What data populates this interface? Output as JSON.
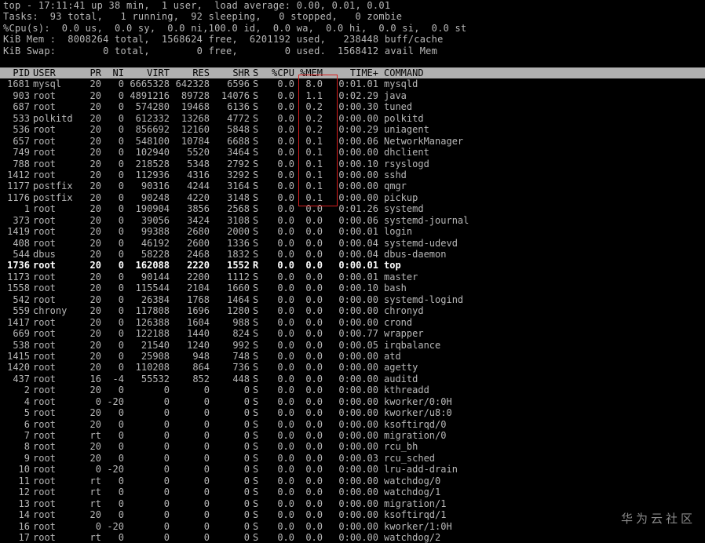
{
  "summary": {
    "line1": "top - 17:11:41 up 38 min,  1 user,  load average: 0.00, 0.01, 0.01",
    "line2": "Tasks:  93 total,   1 running,  92 sleeping,   0 stopped,   0 zombie",
    "line3": "%Cpu(s):  0.0 us,  0.0 sy,  0.0 ni,100.0 id,  0.0 wa,  0.0 hi,  0.0 si,  0.0 st",
    "line4": "KiB Mem :  8008264 total,  1568624 free,  6201192 used,   238448 buff/cache",
    "line5": "KiB Swap:        0 total,        0 free,        0 used.  1568412 avail Mem"
  },
  "header": {
    "pid": "PID",
    "user": "USER",
    "pr": "PR",
    "ni": "NI",
    "virt": "VIRT",
    "res": "RES",
    "shr": "SHR",
    "s": "S",
    "cpu": "%CPU",
    "mem": "%MEM",
    "time": "TIME+",
    "command": "COMMAND"
  },
  "highlight": {
    "color": "#d82020",
    "column": "%MEM"
  },
  "processes": [
    {
      "pid": "1681",
      "user": "mysql",
      "pr": "20",
      "ni": "0",
      "virt": "6665328",
      "res": "642328",
      "shr": "6596",
      "s": "S",
      "cpu": "0.0",
      "mem": "8.0",
      "time": "0:01.01",
      "command": "mysqld"
    },
    {
      "pid": "903",
      "user": "root",
      "pr": "20",
      "ni": "0",
      "virt": "4891216",
      "res": "89728",
      "shr": "14076",
      "s": "S",
      "cpu": "0.0",
      "mem": "1.1",
      "time": "0:02.29",
      "command": "java"
    },
    {
      "pid": "687",
      "user": "root",
      "pr": "20",
      "ni": "0",
      "virt": "574280",
      "res": "19468",
      "shr": "6136",
      "s": "S",
      "cpu": "0.0",
      "mem": "0.2",
      "time": "0:00.30",
      "command": "tuned"
    },
    {
      "pid": "533",
      "user": "polkitd",
      "pr": "20",
      "ni": "0",
      "virt": "612332",
      "res": "13268",
      "shr": "4772",
      "s": "S",
      "cpu": "0.0",
      "mem": "0.2",
      "time": "0:00.00",
      "command": "polkitd"
    },
    {
      "pid": "536",
      "user": "root",
      "pr": "20",
      "ni": "0",
      "virt": "856692",
      "res": "12160",
      "shr": "5848",
      "s": "S",
      "cpu": "0.0",
      "mem": "0.2",
      "time": "0:00.29",
      "command": "uniagent"
    },
    {
      "pid": "657",
      "user": "root",
      "pr": "20",
      "ni": "0",
      "virt": "548100",
      "res": "10784",
      "shr": "6688",
      "s": "S",
      "cpu": "0.0",
      "mem": "0.1",
      "time": "0:00.06",
      "command": "NetworkManager"
    },
    {
      "pid": "749",
      "user": "root",
      "pr": "20",
      "ni": "0",
      "virt": "102940",
      "res": "5520",
      "shr": "3464",
      "s": "S",
      "cpu": "0.0",
      "mem": "0.1",
      "time": "0:00.00",
      "command": "dhclient"
    },
    {
      "pid": "788",
      "user": "root",
      "pr": "20",
      "ni": "0",
      "virt": "218528",
      "res": "5348",
      "shr": "2792",
      "s": "S",
      "cpu": "0.0",
      "mem": "0.1",
      "time": "0:00.10",
      "command": "rsyslogd"
    },
    {
      "pid": "1412",
      "user": "root",
      "pr": "20",
      "ni": "0",
      "virt": "112936",
      "res": "4316",
      "shr": "3292",
      "s": "S",
      "cpu": "0.0",
      "mem": "0.1",
      "time": "0:00.00",
      "command": "sshd"
    },
    {
      "pid": "1177",
      "user": "postfix",
      "pr": "20",
      "ni": "0",
      "virt": "90316",
      "res": "4244",
      "shr": "3164",
      "s": "S",
      "cpu": "0.0",
      "mem": "0.1",
      "time": "0:00.00",
      "command": "qmgr"
    },
    {
      "pid": "1176",
      "user": "postfix",
      "pr": "20",
      "ni": "0",
      "virt": "90248",
      "res": "4220",
      "shr": "3148",
      "s": "S",
      "cpu": "0.0",
      "mem": "0.1",
      "time": "0:00.00",
      "command": "pickup"
    },
    {
      "pid": "1",
      "user": "root",
      "pr": "20",
      "ni": "0",
      "virt": "190904",
      "res": "3856",
      "shr": "2568",
      "s": "S",
      "cpu": "0.0",
      "mem": "0.0",
      "time": "0:01.26",
      "command": "systemd"
    },
    {
      "pid": "373",
      "user": "root",
      "pr": "20",
      "ni": "0",
      "virt": "39056",
      "res": "3424",
      "shr": "3108",
      "s": "S",
      "cpu": "0.0",
      "mem": "0.0",
      "time": "0:00.06",
      "command": "systemd-journal"
    },
    {
      "pid": "1419",
      "user": "root",
      "pr": "20",
      "ni": "0",
      "virt": "99388",
      "res": "2680",
      "shr": "2000",
      "s": "S",
      "cpu": "0.0",
      "mem": "0.0",
      "time": "0:00.01",
      "command": "login"
    },
    {
      "pid": "408",
      "user": "root",
      "pr": "20",
      "ni": "0",
      "virt": "46192",
      "res": "2600",
      "shr": "1336",
      "s": "S",
      "cpu": "0.0",
      "mem": "0.0",
      "time": "0:00.04",
      "command": "systemd-udevd"
    },
    {
      "pid": "544",
      "user": "dbus",
      "pr": "20",
      "ni": "0",
      "virt": "58228",
      "res": "2468",
      "shr": "1832",
      "s": "S",
      "cpu": "0.0",
      "mem": "0.0",
      "time": "0:00.04",
      "command": "dbus-daemon"
    },
    {
      "pid": "1736",
      "user": "root",
      "pr": "20",
      "ni": "0",
      "virt": "162088",
      "res": "2220",
      "shr": "1552",
      "s": "R",
      "cpu": "0.0",
      "mem": "0.0",
      "time": "0:00.01",
      "command": "top",
      "bold": true
    },
    {
      "pid": "1173",
      "user": "root",
      "pr": "20",
      "ni": "0",
      "virt": "90144",
      "res": "2200",
      "shr": "1112",
      "s": "S",
      "cpu": "0.0",
      "mem": "0.0",
      "time": "0:00.01",
      "command": "master"
    },
    {
      "pid": "1558",
      "user": "root",
      "pr": "20",
      "ni": "0",
      "virt": "115544",
      "res": "2104",
      "shr": "1660",
      "s": "S",
      "cpu": "0.0",
      "mem": "0.0",
      "time": "0:00.10",
      "command": "bash"
    },
    {
      "pid": "542",
      "user": "root",
      "pr": "20",
      "ni": "0",
      "virt": "26384",
      "res": "1768",
      "shr": "1464",
      "s": "S",
      "cpu": "0.0",
      "mem": "0.0",
      "time": "0:00.00",
      "command": "systemd-logind"
    },
    {
      "pid": "559",
      "user": "chrony",
      "pr": "20",
      "ni": "0",
      "virt": "117808",
      "res": "1696",
      "shr": "1280",
      "s": "S",
      "cpu": "0.0",
      "mem": "0.0",
      "time": "0:00.00",
      "command": "chronyd"
    },
    {
      "pid": "1417",
      "user": "root",
      "pr": "20",
      "ni": "0",
      "virt": "126388",
      "res": "1604",
      "shr": "988",
      "s": "S",
      "cpu": "0.0",
      "mem": "0.0",
      "time": "0:00.00",
      "command": "crond"
    },
    {
      "pid": "669",
      "user": "root",
      "pr": "20",
      "ni": "0",
      "virt": "122188",
      "res": "1440",
      "shr": "824",
      "s": "S",
      "cpu": "0.0",
      "mem": "0.0",
      "time": "0:00.77",
      "command": "wrapper"
    },
    {
      "pid": "538",
      "user": "root",
      "pr": "20",
      "ni": "0",
      "virt": "21540",
      "res": "1240",
      "shr": "992",
      "s": "S",
      "cpu": "0.0",
      "mem": "0.0",
      "time": "0:00.05",
      "command": "irqbalance"
    },
    {
      "pid": "1415",
      "user": "root",
      "pr": "20",
      "ni": "0",
      "virt": "25908",
      "res": "948",
      "shr": "748",
      "s": "S",
      "cpu": "0.0",
      "mem": "0.0",
      "time": "0:00.00",
      "command": "atd"
    },
    {
      "pid": "1420",
      "user": "root",
      "pr": "20",
      "ni": "0",
      "virt": "110208",
      "res": "864",
      "shr": "736",
      "s": "S",
      "cpu": "0.0",
      "mem": "0.0",
      "time": "0:00.00",
      "command": "agetty"
    },
    {
      "pid": "437",
      "user": "root",
      "pr": "16",
      "ni": "-4",
      "virt": "55532",
      "res": "852",
      "shr": "448",
      "s": "S",
      "cpu": "0.0",
      "mem": "0.0",
      "time": "0:00.00",
      "command": "auditd"
    },
    {
      "pid": "2",
      "user": "root",
      "pr": "20",
      "ni": "0",
      "virt": "0",
      "res": "0",
      "shr": "0",
      "s": "S",
      "cpu": "0.0",
      "mem": "0.0",
      "time": "0:00.00",
      "command": "kthreadd"
    },
    {
      "pid": "4",
      "user": "root",
      "pr": "0",
      "ni": "-20",
      "virt": "0",
      "res": "0",
      "shr": "0",
      "s": "S",
      "cpu": "0.0",
      "mem": "0.0",
      "time": "0:00.00",
      "command": "kworker/0:0H"
    },
    {
      "pid": "5",
      "user": "root",
      "pr": "20",
      "ni": "0",
      "virt": "0",
      "res": "0",
      "shr": "0",
      "s": "S",
      "cpu": "0.0",
      "mem": "0.0",
      "time": "0:00.00",
      "command": "kworker/u8:0"
    },
    {
      "pid": "6",
      "user": "root",
      "pr": "20",
      "ni": "0",
      "virt": "0",
      "res": "0",
      "shr": "0",
      "s": "S",
      "cpu": "0.0",
      "mem": "0.0",
      "time": "0:00.00",
      "command": "ksoftirqd/0"
    },
    {
      "pid": "7",
      "user": "root",
      "pr": "rt",
      "ni": "0",
      "virt": "0",
      "res": "0",
      "shr": "0",
      "s": "S",
      "cpu": "0.0",
      "mem": "0.0",
      "time": "0:00.00",
      "command": "migration/0"
    },
    {
      "pid": "8",
      "user": "root",
      "pr": "20",
      "ni": "0",
      "virt": "0",
      "res": "0",
      "shr": "0",
      "s": "S",
      "cpu": "0.0",
      "mem": "0.0",
      "time": "0:00.00",
      "command": "rcu_bh"
    },
    {
      "pid": "9",
      "user": "root",
      "pr": "20",
      "ni": "0",
      "virt": "0",
      "res": "0",
      "shr": "0",
      "s": "S",
      "cpu": "0.0",
      "mem": "0.0",
      "time": "0:00.03",
      "command": "rcu_sched"
    },
    {
      "pid": "10",
      "user": "root",
      "pr": "0",
      "ni": "-20",
      "virt": "0",
      "res": "0",
      "shr": "0",
      "s": "S",
      "cpu": "0.0",
      "mem": "0.0",
      "time": "0:00.00",
      "command": "lru-add-drain"
    },
    {
      "pid": "11",
      "user": "root",
      "pr": "rt",
      "ni": "0",
      "virt": "0",
      "res": "0",
      "shr": "0",
      "s": "S",
      "cpu": "0.0",
      "mem": "0.0",
      "time": "0:00.00",
      "command": "watchdog/0"
    },
    {
      "pid": "12",
      "user": "root",
      "pr": "rt",
      "ni": "0",
      "virt": "0",
      "res": "0",
      "shr": "0",
      "s": "S",
      "cpu": "0.0",
      "mem": "0.0",
      "time": "0:00.00",
      "command": "watchdog/1"
    },
    {
      "pid": "13",
      "user": "root",
      "pr": "rt",
      "ni": "0",
      "virt": "0",
      "res": "0",
      "shr": "0",
      "s": "S",
      "cpu": "0.0",
      "mem": "0.0",
      "time": "0:00.00",
      "command": "migration/1"
    },
    {
      "pid": "14",
      "user": "root",
      "pr": "20",
      "ni": "0",
      "virt": "0",
      "res": "0",
      "shr": "0",
      "s": "S",
      "cpu": "0.0",
      "mem": "0.0",
      "time": "0:00.00",
      "command": "ksoftirqd/1"
    },
    {
      "pid": "16",
      "user": "root",
      "pr": "0",
      "ni": "-20",
      "virt": "0",
      "res": "0",
      "shr": "0",
      "s": "S",
      "cpu": "0.0",
      "mem": "0.0",
      "time": "0:00.00",
      "command": "kworker/1:0H"
    },
    {
      "pid": "17",
      "user": "root",
      "pr": "rt",
      "ni": "0",
      "virt": "0",
      "res": "0",
      "shr": "0",
      "s": "S",
      "cpu": "0.0",
      "mem": "0.0",
      "time": "0:00.00",
      "command": "watchdog/2"
    }
  ],
  "watermark": "华为云社区"
}
